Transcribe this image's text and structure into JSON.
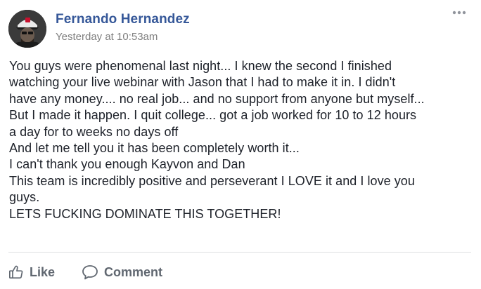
{
  "post": {
    "author_name": "Fernando Hernandez",
    "timestamp": "Yesterday at 10:53am",
    "more_icon": "more-options-icon",
    "avatar_icon": "avatar",
    "body_lines": [
      "You guys were phenomenal last night... I knew the second I finished",
      "watching your live webinar with Jason that I had to make it in. I didn't",
      "have any money.... no real job... and no support from anyone but myself...",
      "But I made it happen. I quit college... got a job worked for 10 to 12 hours",
      "a day for to weeks no days off",
      "And let me tell you it has been completely worth it...",
      "I can't thank you enough Kayvon and Dan",
      "This team is incredibly positive and perseverant I LOVE it and I love you",
      "guys.",
      "LETS FUCKING DOMINATE THIS TOGETHER!"
    ]
  },
  "actions": {
    "like_label": "Like",
    "like_icon": "thumbs-up-icon",
    "comment_label": "Comment",
    "comment_icon": "speech-bubble-icon"
  },
  "colors": {
    "author": "#365899",
    "text": "#1d2129",
    "muted": "#7f7f7f",
    "action": "#606770",
    "divider": "#dddfe2"
  }
}
